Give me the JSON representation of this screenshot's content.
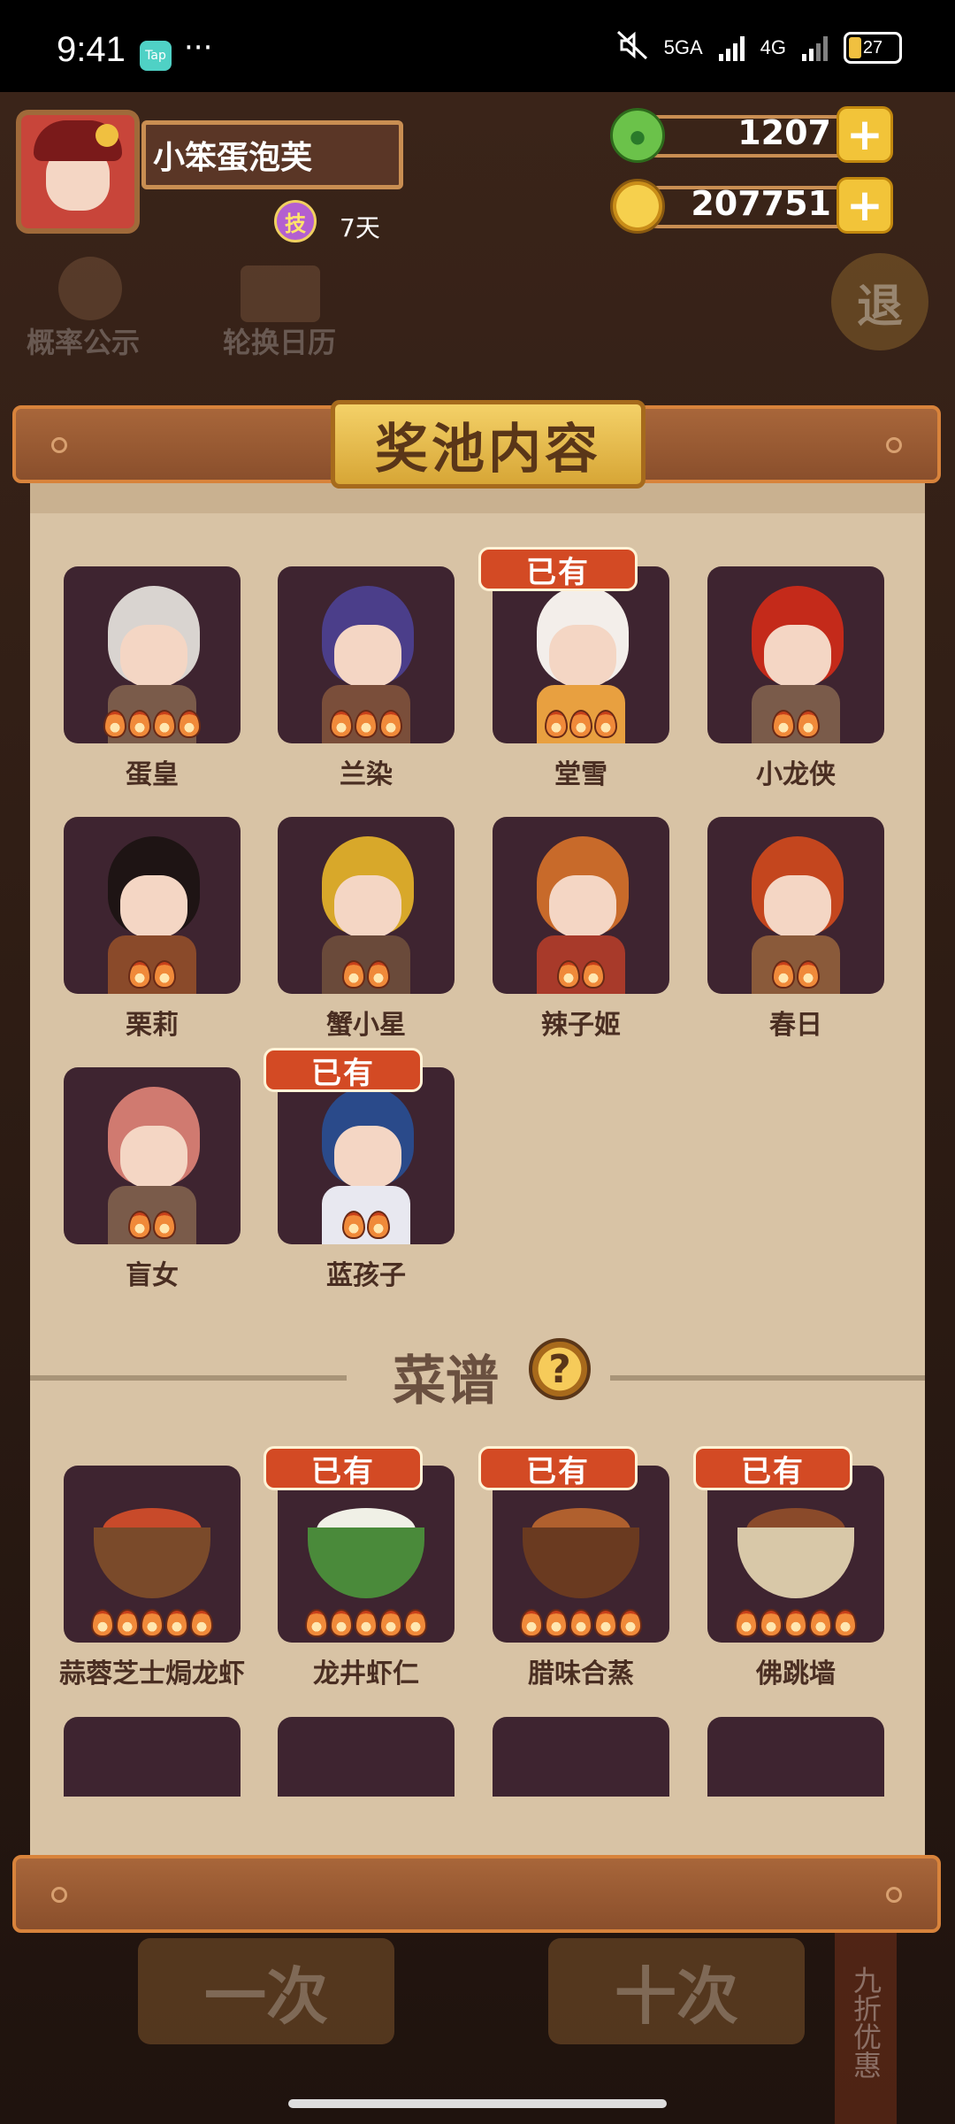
{
  "status": {
    "time": "9:41",
    "tap_badge": "Tap",
    "more": "···",
    "net1": "5GA",
    "net2": "4G",
    "battery": "27"
  },
  "player": {
    "name": "小笨蛋泡芙",
    "skill_icon_text": "技",
    "skill_days": "7天"
  },
  "currency": {
    "jade": "1207",
    "coins": "207751",
    "plus": "+"
  },
  "background": {
    "probability": "概率公示",
    "calendar": "轮换日历",
    "back": "退",
    "btn_one": "一次",
    "btn_ten": "十次",
    "promo": "九折优惠"
  },
  "panel": {
    "title": "奖池内容",
    "recipes_label": "菜谱",
    "help": "?"
  },
  "owned_label": "已有",
  "characters": [
    {
      "name": "蛋皇",
      "stars": 4,
      "owned": false,
      "hair": "#d9d4d0",
      "outfit": "#7a5b4a"
    },
    {
      "name": "兰染",
      "stars": 3,
      "owned": false,
      "hair": "#4b3e8a",
      "outfit": "#7a4e3a"
    },
    {
      "name": "堂雪",
      "stars": 3,
      "owned": true,
      "hair": "#f3eeea",
      "outfit": "#e8a040"
    },
    {
      "name": "小龙侠",
      "stars": 2,
      "owned": false,
      "hair": "#c42a1a",
      "outfit": "#7a5b4a"
    },
    {
      "name": "栗莉",
      "stars": 2,
      "owned": false,
      "hair": "#1e1414",
      "outfit": "#8a4a2a"
    },
    {
      "name": "蟹小星",
      "stars": 2,
      "owned": false,
      "hair": "#d8a82a",
      "outfit": "#6a4a3a"
    },
    {
      "name": "辣子姬",
      "stars": 2,
      "owned": false,
      "hair": "#c86a2a",
      "outfit": "#a83a2a"
    },
    {
      "name": "春日",
      "stars": 2,
      "owned": false,
      "hair": "#c4461e",
      "outfit": "#8a5a3a"
    },
    {
      "name": "盲女",
      "stars": 2,
      "owned": false,
      "hair": "#d07a70",
      "outfit": "#7a5b4a"
    },
    {
      "name": "蓝孩子",
      "stars": 2,
      "owned": true,
      "hair": "#2a4a8a",
      "outfit": "#e8e8f0"
    }
  ],
  "recipes": [
    {
      "name": "蒜蓉芝士焗龙虾",
      "stars": 5,
      "owned": false,
      "bowl": "#7a4a2a",
      "food": "#c84a2a"
    },
    {
      "name": "龙井虾仁",
      "stars": 5,
      "owned": true,
      "bowl": "#4a8a3a",
      "food": "#f0f0e6"
    },
    {
      "name": "腊味合蒸",
      "stars": 5,
      "owned": true,
      "bowl": "#6a3a20",
      "food": "#b0602e"
    },
    {
      "name": "佛跳墙",
      "stars": 5,
      "owned": true,
      "bowl": "#d8c8a8",
      "food": "#8a4a2a"
    }
  ],
  "colors": {
    "owned_badge": "#d34a24",
    "card_bg": "#3e2430",
    "paper": "#d8c3a5",
    "plaque": "#f4d168"
  }
}
